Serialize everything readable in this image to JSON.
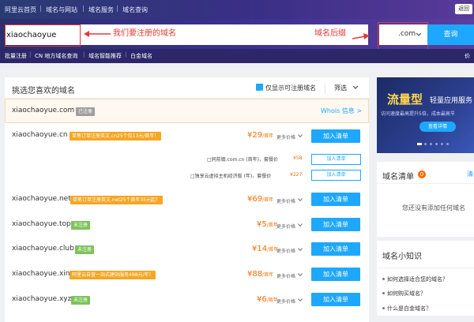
{
  "breadcrumb": {
    "home": "阿里云首页",
    "cat": "域名与网站",
    "svc": "域名服务",
    "page": "域名查询",
    "ret": "返回"
  },
  "search": {
    "value": "xiaochaoyue",
    "suffix": ".com",
    "button": "查询"
  },
  "annotations": {
    "input": "我们要注册的域名",
    "suffix": "域名后缀"
  },
  "subnav": {
    "items": [
      "批量注册",
      "CN 地方域名查询",
      "域名智能推荐",
      "白金域名"
    ],
    "right": "价"
  },
  "list": {
    "title": "挑选您喜欢的域名",
    "filter_label": "仅显示可注册域名",
    "sort_label": "筛选",
    "registered": {
      "domain": "xiaochaoyue.com",
      "tag": "已注册",
      "whois": "Whois 信息 >"
    },
    "rows": [
      {
        "domain": "xiaochaoyue.cn",
        "tag": "单笔订单注册英文.cn25个仅13元/首年！",
        "tag_color": "#f5a623",
        "price": "¥29",
        "unit": "/首年",
        "more": "更多价格",
        "add": "加入清单"
      },
      {
        "domain": "xiaochaoyue.net",
        "tag": "单笔订单注册英文.net25个首年35元起！",
        "tag_color": "#f5a623",
        "price": "¥69",
        "unit": "/首年",
        "more": "更多价格",
        "add": "加入清单"
      },
      {
        "domain": "xiaochaoyue.top",
        "tag": "未注册",
        "tag_color": "#7cc35a",
        "price": "¥5",
        "unit": "/首年",
        "more": "更多价格",
        "add": "加入清单"
      },
      {
        "domain": "xiaochaoyue.club",
        "tag": "未注册",
        "tag_color": "#7cc35a",
        "price": "¥14",
        "unit": "/首年",
        "more": "更多价格",
        "add": "加入清单"
      },
      {
        "domain": "xiaochaoyue.xin",
        "tag": "阿里云自营一站式建站服务498元/年！",
        "tag_color": "#f5a623",
        "price": "¥88",
        "unit": "/首年",
        "more": "更多价格",
        "add": "加入清单"
      },
      {
        "domain": "xiaochaoyue.xyz",
        "tag": "未注册",
        "tag_color": "#7cc35a",
        "price": "¥6",
        "unit": "/首年",
        "more": "更多价格",
        "add": "加入清单"
      }
    ],
    "combos": [
      {
        "text": "□同前缀.com.cn (首年)，套餐价",
        "price": "¥58",
        "add": "加入清单"
      },
      {
        "text": "□独享云虚拟主机经济版 (年)，套餐价",
        "price": "¥227",
        "add": "加入清单"
      }
    ]
  },
  "banner": {
    "title": "流量型",
    "subtitle": "轻量应用服务",
    "desc": "访问速度最高提升5倍，成本最高节",
    "button": "查看详情"
  },
  "cart": {
    "title": "域名清单",
    "count": "0",
    "link": "清",
    "empty": "您还没有添加任何域名"
  },
  "knowledge": {
    "title": "域名小知识",
    "items": [
      "如何选择适合您的域名？",
      "如何购买域名？",
      "什么是白金域名？"
    ]
  }
}
